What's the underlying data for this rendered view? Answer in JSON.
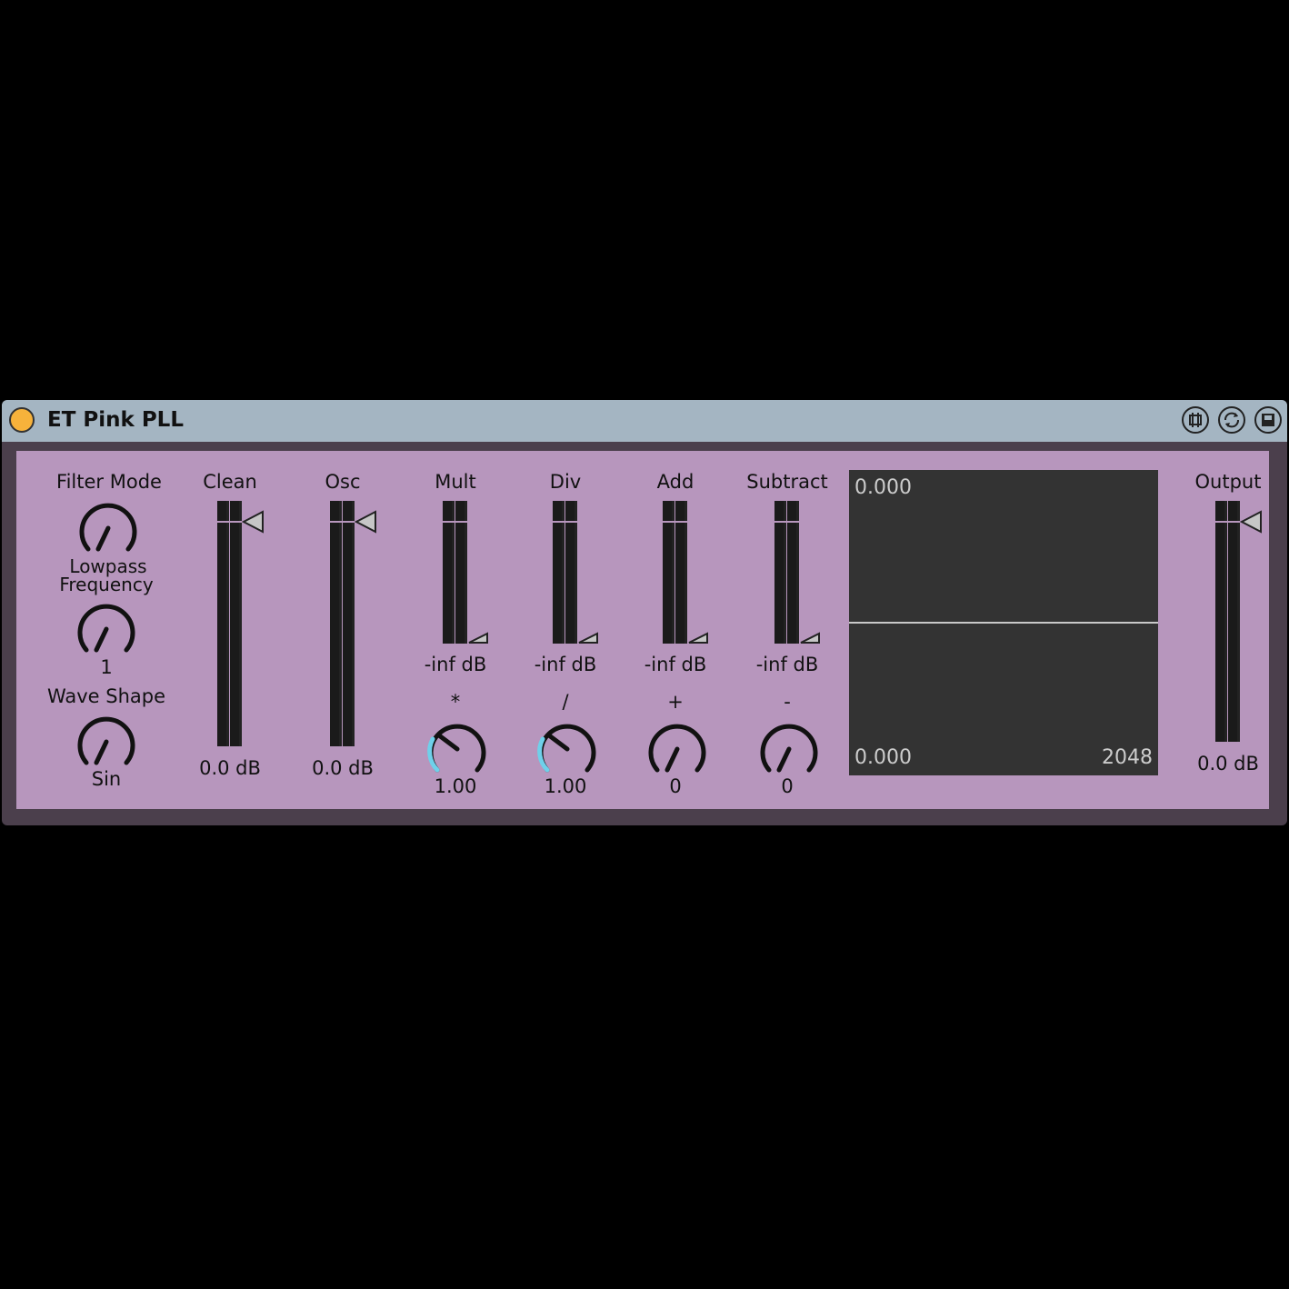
{
  "device": {
    "title": "ET Pink PLL",
    "colors": {
      "panel": "#b796bd",
      "titlebar": "#a4b5c2",
      "power": "#f7b23b",
      "accent": "#6fd0ea"
    }
  },
  "controls": {
    "filter_mode": {
      "label": "Filter Mode"
    },
    "lowpass": {
      "label_line1": "Lowpass",
      "label_line2": "Frequency",
      "value": "1"
    },
    "wave_shape": {
      "label": "Wave Shape",
      "value": "Sin"
    }
  },
  "meters": {
    "clean": {
      "label": "Clean",
      "value": "0.0 dB"
    },
    "osc": {
      "label": "Osc",
      "value": "0.0 dB"
    },
    "mult": {
      "label": "Mult",
      "value": "-inf dB",
      "symbol": "*",
      "knob_value": "1.00"
    },
    "div": {
      "label": "Div",
      "value": "-inf dB",
      "symbol": "/",
      "knob_value": "1.00"
    },
    "add": {
      "label": "Add",
      "value": "-inf dB",
      "symbol": "+",
      "knob_value": "0"
    },
    "subtract": {
      "label": "Subtract",
      "value": "-inf dB",
      "symbol": "-",
      "knob_value": "0"
    },
    "output": {
      "label": "Output",
      "value": "0.0 dB"
    }
  },
  "scope": {
    "top_value": "0.000",
    "bottom_value": "0.000",
    "right_value": "2048"
  },
  "icons": [
    "power-icon",
    "hot-swap-icon",
    "refresh-icon",
    "save-icon"
  ]
}
